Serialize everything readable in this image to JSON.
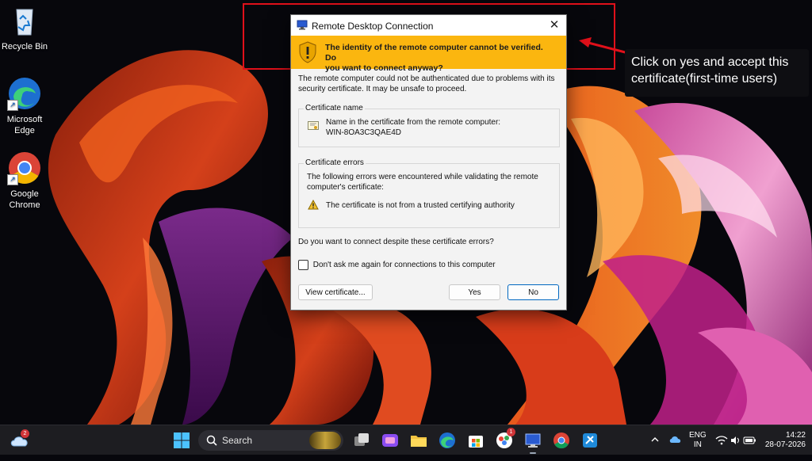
{
  "desktop": {
    "icons": [
      {
        "label": "Recycle Bin"
      },
      {
        "label_line1": "Microsoft",
        "label_line2": "Edge"
      },
      {
        "label_line1": "Google",
        "label_line2": "Chrome"
      }
    ]
  },
  "annotation": {
    "text_line1": "Click on yes and accept this",
    "text_line2": "certificate(first-time users)"
  },
  "dialog": {
    "title": "Remote Desktop Connection",
    "warning_line1": "The identity of the remote computer cannot be verified. Do",
    "warning_line2": "you want to connect anyway?",
    "intro_line1": "The remote computer could not be authenticated due to problems with its",
    "intro_line2": "security certificate. It may be unsafe to proceed.",
    "cert_name_group": "Certificate name",
    "cert_name_label": "Name in the certificate from the remote computer:",
    "cert_name_value": "WIN-8OA3C3QAE4D",
    "cert_errors_group": "Certificate errors",
    "errors_line1": "The following errors were encountered while validating the remote",
    "errors_line2": "computer's certificate:",
    "error_item": "The certificate is not from a trusted certifying authority",
    "question": "Do you want to connect despite these certificate errors?",
    "checkbox_label": "Don't ask me again for connections to this computer",
    "checkbox_checked": false,
    "view_button": "View certificate...",
    "yes_button": "Yes",
    "no_button": "No"
  },
  "taskbar": {
    "weather_badge": "2",
    "search_label": "Search",
    "app_badge": "1",
    "lang_line1": "ENG",
    "lang_line2": "IN",
    "time": "14:22",
    "date": "28-07-2026"
  }
}
